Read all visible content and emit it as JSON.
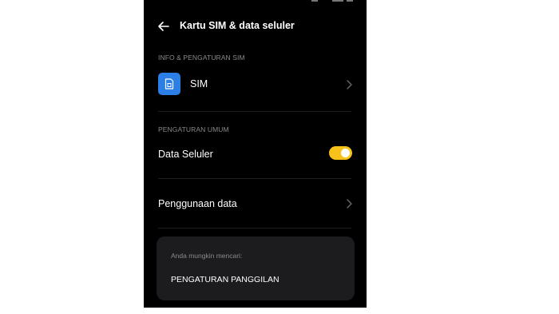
{
  "header": {
    "title": "Kartu SIM & data seluler"
  },
  "sim_section": {
    "label": "INFO & PENGATURAN SIM",
    "sim_item": {
      "label": "SIM",
      "icon": "sim-card-icon"
    }
  },
  "general_section": {
    "label": "PENGATURAN UMUM",
    "mobile_data": {
      "label": "Data Seluler",
      "enabled": true
    },
    "data_usage": {
      "label": "Penggunaan data"
    }
  },
  "suggestions": {
    "heading": "Anda mungkin mencari:",
    "items": [
      "PENGATURAN PANGGILAN"
    ]
  },
  "colors": {
    "background": "#000000",
    "accent_toggle": "#f7c21a",
    "sim_icon": "#2b7fe6",
    "card": "#1c1c1e"
  }
}
